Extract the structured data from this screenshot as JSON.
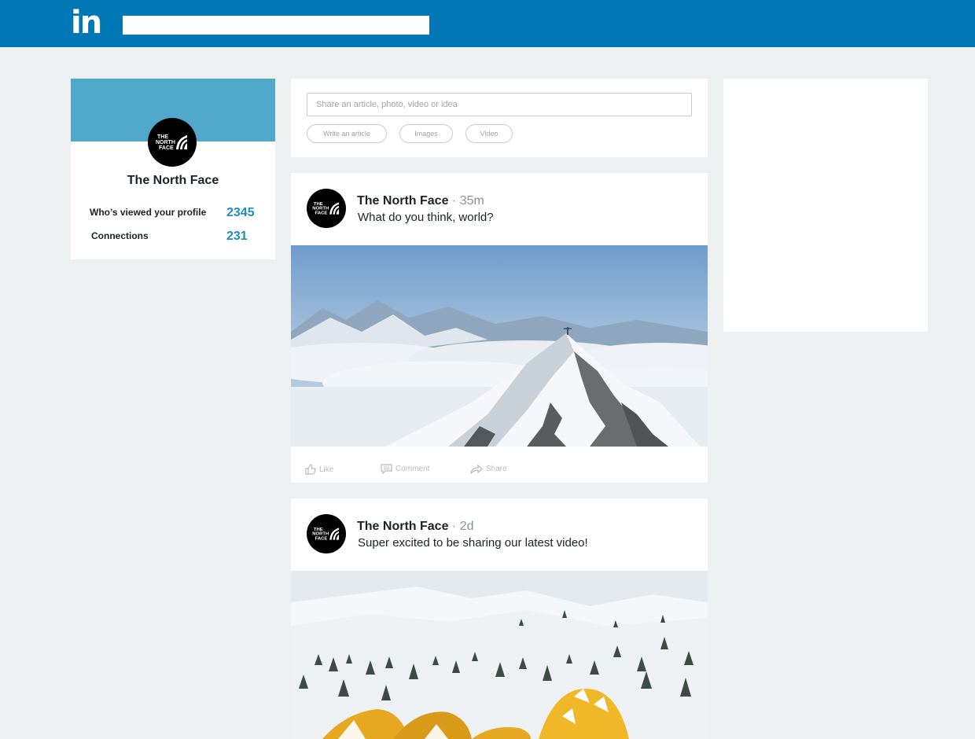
{
  "topbar": {
    "logo_text": "in",
    "search_value": ""
  },
  "profile": {
    "name": "The North Face",
    "logo_text": "THE NORTH FACE",
    "stats": [
      {
        "label": "Who’s viewed your profile",
        "value": "2345"
      },
      {
        "label": "Connections",
        "value": "231"
      }
    ]
  },
  "share": {
    "placeholder": "Share an article, photo, video or idea",
    "buttons": [
      "Write an article",
      "Images",
      "Video"
    ]
  },
  "posts": [
    {
      "author": "The North Face",
      "time": "· 35m",
      "text": "What do you think, world?",
      "actions": [
        "Like",
        "Comment",
        "Share"
      ]
    },
    {
      "author": "The North Face",
      "time": "· 2d",
      "text": "Super excited to be sharing our latest video!"
    }
  ],
  "colors": {
    "brand": "#0077b5",
    "banner": "#50a9ca",
    "stat_value": "#1f8dc4",
    "background": "#edf0f0"
  }
}
